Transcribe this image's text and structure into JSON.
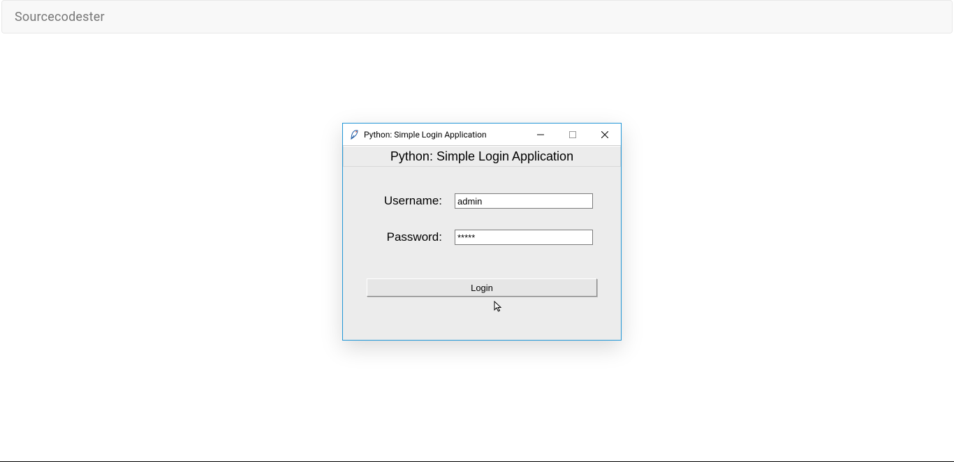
{
  "page": {
    "brand": "Sourcecodester"
  },
  "window": {
    "title": "Python: Simple Login Application",
    "header": "Python: Simple Login Application",
    "form": {
      "username_label": "Username:",
      "username_value": "admin",
      "password_label": "Password:",
      "password_value": "*****"
    },
    "login_button": "Login"
  }
}
